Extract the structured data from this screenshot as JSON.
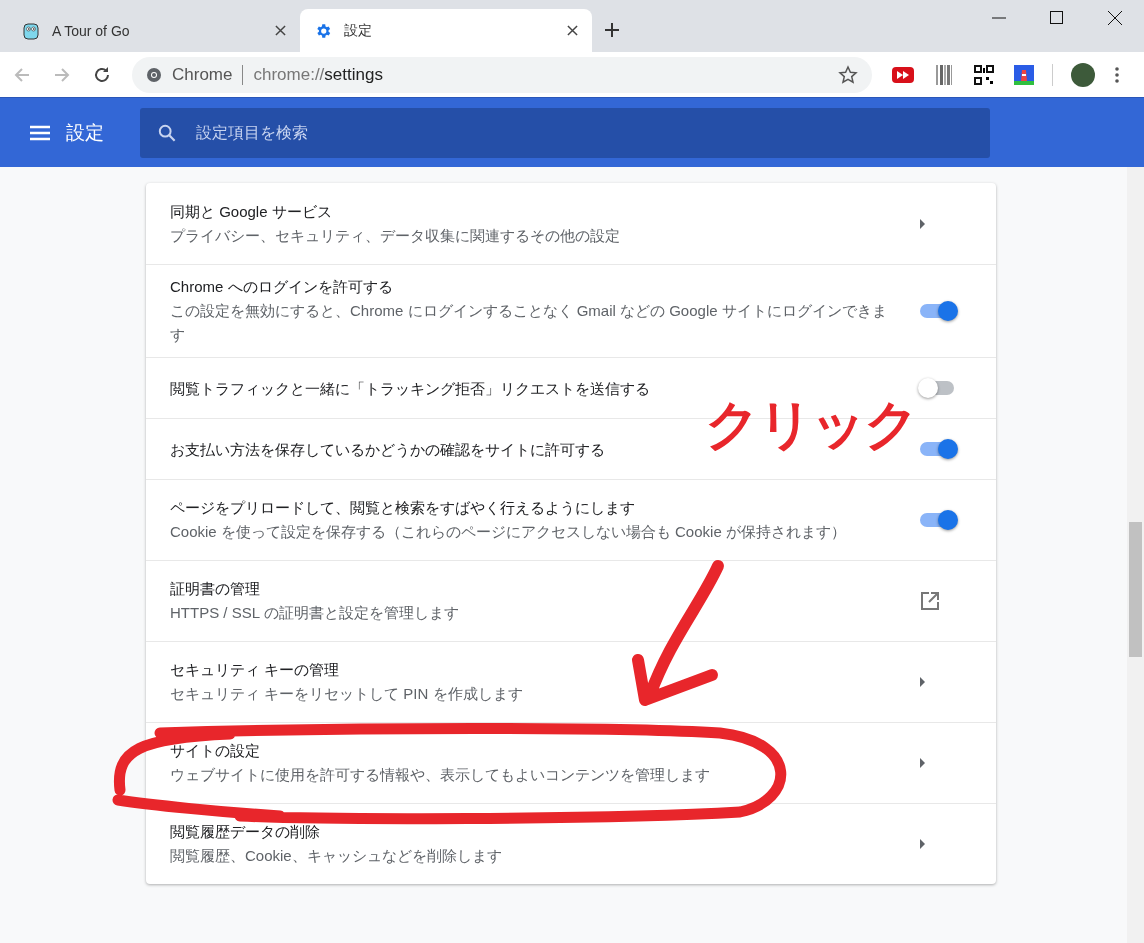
{
  "tabs": [
    {
      "title": "A Tour of Go",
      "selected": false
    },
    {
      "title": "設定",
      "selected": true
    }
  ],
  "address_bar": {
    "site_label": "Chrome",
    "scheme": "chrome://",
    "path": "settings"
  },
  "header": {
    "title": "設定",
    "search": {
      "placeholder": "設定項目を検索"
    }
  },
  "settings": [
    {
      "kind": "arrow",
      "title": "同期と Google サービス",
      "description": "プライバシー、セキュリティ、データ収集に関連するその他の設定"
    },
    {
      "kind": "toggle",
      "on": true,
      "title": "Chrome へのログインを許可する",
      "description": "この設定を無効にすると、Chrome にログインすることなく Gmail などの Google サイトにログインできます"
    },
    {
      "kind": "toggle",
      "on": false,
      "title": "閲覧トラフィックと一緒に「トラッキング拒否」リクエストを送信する"
    },
    {
      "kind": "toggle",
      "on": true,
      "title": "お支払い方法を保存しているかどうかの確認をサイトに許可する"
    },
    {
      "kind": "toggle",
      "on": true,
      "title": "ページをプリロードして、閲覧と検索をすばやく行えるようにします",
      "description": "Cookie を使って設定を保存する（これらのページにアクセスしない場合も Cookie が保持されます）"
    },
    {
      "kind": "external",
      "title": "証明書の管理",
      "description": "HTTPS / SSL の証明書と設定を管理します"
    },
    {
      "kind": "arrow",
      "title": "セキュリティ キーの管理",
      "description": "セキュリティ キーをリセットして PIN を作成します"
    },
    {
      "kind": "arrow",
      "title": "サイトの設定",
      "description": "ウェブサイトに使用を許可する情報や、表示してもよいコンテンツを管理します"
    },
    {
      "kind": "arrow",
      "title": "閲覧履歴データの削除",
      "description": "閲覧履歴、Cookie、キャッシュなどを削除します"
    }
  ],
  "annotation": {
    "text": "クリック"
  }
}
